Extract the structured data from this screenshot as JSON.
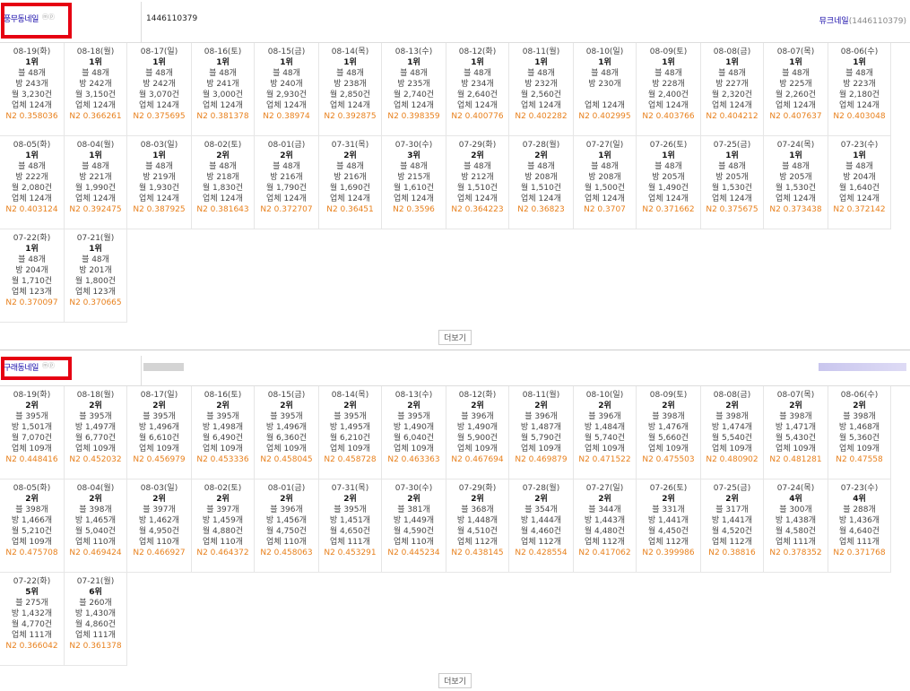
{
  "places": [
    {
      "name": "풍무동네일",
      "badges": "ⓜⓟ",
      "place_id": "1446110379",
      "right_name": "뮤크네일",
      "right_id": "(1446110379)",
      "more_label": "더보기",
      "days": [
        {
          "date": "08-19(화)",
          "rank": "1위",
          "l1": "블 48개",
          "l2": "방 243개",
          "l3": "월 3,230건",
          "l4": "업체 124개",
          "n2": "N2 0.358036"
        },
        {
          "date": "08-18(월)",
          "rank": "1위",
          "l1": "블 48개",
          "l2": "방 242개",
          "l3": "월 3,150건",
          "l4": "업체 124개",
          "n2": "N2 0.366261"
        },
        {
          "date": "08-17(일)",
          "rank": "1위",
          "l1": "블 48개",
          "l2": "방 242개",
          "l3": "월 3,070건",
          "l4": "업체 124개",
          "n2": "N2 0.375695"
        },
        {
          "date": "08-16(토)",
          "rank": "1위",
          "l1": "블 48개",
          "l2": "방 241개",
          "l3": "월 3,000건",
          "l4": "업체 124개",
          "n2": "N2 0.381378"
        },
        {
          "date": "08-15(금)",
          "rank": "1위",
          "l1": "블 48개",
          "l2": "방 240개",
          "l3": "월 2,930건",
          "l4": "업체 124개",
          "n2": "N2 0.38974"
        },
        {
          "date": "08-14(목)",
          "rank": "1위",
          "l1": "블 48개",
          "l2": "방 238개",
          "l3": "월 2,850건",
          "l4": "업체 124개",
          "n2": "N2 0.392875"
        },
        {
          "date": "08-13(수)",
          "rank": "1위",
          "l1": "블 48개",
          "l2": "방 235개",
          "l3": "월 2,740건",
          "l4": "업체 124개",
          "n2": "N2 0.398359"
        },
        {
          "date": "08-12(화)",
          "rank": "1위",
          "l1": "블 48개",
          "l2": "방 234개",
          "l3": "월 2,640건",
          "l4": "업체 124개",
          "n2": "N2 0.400776"
        },
        {
          "date": "08-11(월)",
          "rank": "1위",
          "l1": "블 48개",
          "l2": "방 232개",
          "l3": "월 2,560건",
          "l4": "업체 124개",
          "n2": "N2 0.402282"
        },
        {
          "date": "08-10(일)",
          "rank": "1위",
          "l1": "블 48개",
          "l2": "방 230개",
          "l3": "",
          "l4": "업체 124개",
          "n2": "N2 0.402995"
        },
        {
          "date": "08-09(토)",
          "rank": "1위",
          "l1": "블 48개",
          "l2": "방 228개",
          "l3": "월 2,400건",
          "l4": "업체 124개",
          "n2": "N2 0.403766"
        },
        {
          "date": "08-08(금)",
          "rank": "1위",
          "l1": "블 48개",
          "l2": "방 227개",
          "l3": "월 2,320건",
          "l4": "업체 124개",
          "n2": "N2 0.404212"
        },
        {
          "date": "08-07(목)",
          "rank": "1위",
          "l1": "블 48개",
          "l2": "방 225개",
          "l3": "월 2,260건",
          "l4": "업체 124개",
          "n2": "N2 0.407637"
        },
        {
          "date": "08-06(수)",
          "rank": "1위",
          "l1": "블 48개",
          "l2": "방 223개",
          "l3": "월 2,180건",
          "l4": "업체 124개",
          "n2": "N2 0.403048"
        },
        {
          "date": "08-05(화)",
          "rank": "1위",
          "l1": "블 48개",
          "l2": "방 222개",
          "l3": "월 2,080건",
          "l4": "업체 124개",
          "n2": "N2 0.403124"
        },
        {
          "date": "08-04(월)",
          "rank": "1위",
          "l1": "블 48개",
          "l2": "방 221개",
          "l3": "월 1,990건",
          "l4": "업체 124개",
          "n2": "N2 0.392475"
        },
        {
          "date": "08-03(일)",
          "rank": "1위",
          "l1": "블 48개",
          "l2": "방 219개",
          "l3": "월 1,930건",
          "l4": "업체 124개",
          "n2": "N2 0.387925"
        },
        {
          "date": "08-02(토)",
          "rank": "2위",
          "l1": "블 48개",
          "l2": "방 218개",
          "l3": "월 1,830건",
          "l4": "업체 124개",
          "n2": "N2 0.381643"
        },
        {
          "date": "08-01(금)",
          "rank": "2위",
          "l1": "블 48개",
          "l2": "방 216개",
          "l3": "월 1,790건",
          "l4": "업체 124개",
          "n2": "N2 0.372707"
        },
        {
          "date": "07-31(목)",
          "rank": "2위",
          "l1": "블 48개",
          "l2": "방 216개",
          "l3": "월 1,690건",
          "l4": "업체 124개",
          "n2": "N2 0.36451"
        },
        {
          "date": "07-30(수)",
          "rank": "3위",
          "l1": "블 48개",
          "l2": "방 215개",
          "l3": "월 1,610건",
          "l4": "업체 124개",
          "n2": "N2 0.3596"
        },
        {
          "date": "07-29(화)",
          "rank": "2위",
          "l1": "블 48개",
          "l2": "방 212개",
          "l3": "월 1,510건",
          "l4": "업체 124개",
          "n2": "N2 0.364223"
        },
        {
          "date": "07-28(월)",
          "rank": "2위",
          "l1": "블 48개",
          "l2": "방 208개",
          "l3": "월 1,510건",
          "l4": "업체 124개",
          "n2": "N2 0.36823"
        },
        {
          "date": "07-27(일)",
          "rank": "1위",
          "l1": "블 48개",
          "l2": "방 208개",
          "l3": "월 1,500건",
          "l4": "업체 124개",
          "n2": "N2 0.3707"
        },
        {
          "date": "07-26(토)",
          "rank": "1위",
          "l1": "블 48개",
          "l2": "방 205개",
          "l3": "월 1,490건",
          "l4": "업체 124개",
          "n2": "N2 0.371662"
        },
        {
          "date": "07-25(금)",
          "rank": "1위",
          "l1": "블 48개",
          "l2": "방 205개",
          "l3": "월 1,530건",
          "l4": "업체 124개",
          "n2": "N2 0.375675"
        },
        {
          "date": "07-24(목)",
          "rank": "1위",
          "l1": "블 48개",
          "l2": "방 205개",
          "l3": "월 1,530건",
          "l4": "업체 124개",
          "n2": "N2 0.373438"
        },
        {
          "date": "07-23(수)",
          "rank": "1위",
          "l1": "블 48개",
          "l2": "방 204개",
          "l3": "월 1,640건",
          "l4": "업체 124개",
          "n2": "N2 0.372142"
        },
        {
          "date": "07-22(화)",
          "rank": "1위",
          "l1": "블 48개",
          "l2": "방 204개",
          "l3": "월 1,710건",
          "l4": "업체 123개",
          "n2": "N2 0.370097"
        },
        {
          "date": "07-21(월)",
          "rank": "1위",
          "l1": "블 48개",
          "l2": "방 201개",
          "l3": "월 1,800건",
          "l4": "업체 123개",
          "n2": "N2 0.370665"
        }
      ]
    },
    {
      "name": "구래동네일",
      "badges": "ⓜⓟ",
      "place_id": "",
      "right_name": "",
      "right_id": "",
      "more_label": "더보기",
      "days": [
        {
          "date": "08-19(화)",
          "rank": "2위",
          "l1": "블 395개",
          "l2": "방 1,501개",
          "l3": "월 7,070건",
          "l4": "업체 109개",
          "n2": "N2 0.448416"
        },
        {
          "date": "08-18(월)",
          "rank": "2위",
          "l1": "블 395개",
          "l2": "방 1,497개",
          "l3": "월 6,770건",
          "l4": "업체 109개",
          "n2": "N2 0.452032"
        },
        {
          "date": "08-17(일)",
          "rank": "2위",
          "l1": "블 395개",
          "l2": "방 1,496개",
          "l3": "월 6,610건",
          "l4": "업체 109개",
          "n2": "N2 0.456979"
        },
        {
          "date": "08-16(토)",
          "rank": "2위",
          "l1": "블 395개",
          "l2": "방 1,498개",
          "l3": "월 6,490건",
          "l4": "업체 109개",
          "n2": "N2 0.453336"
        },
        {
          "date": "08-15(금)",
          "rank": "2위",
          "l1": "블 395개",
          "l2": "방 1,496개",
          "l3": "월 6,360건",
          "l4": "업체 109개",
          "n2": "N2 0.458045"
        },
        {
          "date": "08-14(목)",
          "rank": "2위",
          "l1": "블 395개",
          "l2": "방 1,495개",
          "l3": "월 6,210건",
          "l4": "업체 109개",
          "n2": "N2 0.458728"
        },
        {
          "date": "08-13(수)",
          "rank": "2위",
          "l1": "블 395개",
          "l2": "방 1,490개",
          "l3": "월 6,040건",
          "l4": "업체 109개",
          "n2": "N2 0.463363"
        },
        {
          "date": "08-12(화)",
          "rank": "2위",
          "l1": "블 396개",
          "l2": "방 1,490개",
          "l3": "월 5,900건",
          "l4": "업체 109개",
          "n2": "N2 0.467694"
        },
        {
          "date": "08-11(월)",
          "rank": "2위",
          "l1": "블 396개",
          "l2": "방 1,487개",
          "l3": "월 5,790건",
          "l4": "업체 109개",
          "n2": "N2 0.469879"
        },
        {
          "date": "08-10(일)",
          "rank": "2위",
          "l1": "블 396개",
          "l2": "방 1,484개",
          "l3": "월 5,740건",
          "l4": "업체 109개",
          "n2": "N2 0.471522"
        },
        {
          "date": "08-09(토)",
          "rank": "2위",
          "l1": "블 398개",
          "l2": "방 1,476개",
          "l3": "월 5,660건",
          "l4": "업체 109개",
          "n2": "N2 0.475503"
        },
        {
          "date": "08-08(금)",
          "rank": "2위",
          "l1": "블 398개",
          "l2": "방 1,474개",
          "l3": "월 5,540건",
          "l4": "업체 109개",
          "n2": "N2 0.480902"
        },
        {
          "date": "08-07(목)",
          "rank": "2위",
          "l1": "블 398개",
          "l2": "방 1,471개",
          "l3": "월 5,430건",
          "l4": "업체 109개",
          "n2": "N2 0.481281"
        },
        {
          "date": "08-06(수)",
          "rank": "2위",
          "l1": "블 398개",
          "l2": "방 1,468개",
          "l3": "월 5,360건",
          "l4": "업체 109개",
          "n2": "N2 0.47558"
        },
        {
          "date": "08-05(화)",
          "rank": "2위",
          "l1": "블 398개",
          "l2": "방 1,466개",
          "l3": "월 5,210건",
          "l4": "업체 109개",
          "n2": "N2 0.475708"
        },
        {
          "date": "08-04(월)",
          "rank": "2위",
          "l1": "블 398개",
          "l2": "방 1,465개",
          "l3": "월 5,040건",
          "l4": "업체 110개",
          "n2": "N2 0.469424"
        },
        {
          "date": "08-03(일)",
          "rank": "2위",
          "l1": "블 397개",
          "l2": "방 1,462개",
          "l3": "월 4,950건",
          "l4": "업체 110개",
          "n2": "N2 0.466927"
        },
        {
          "date": "08-02(토)",
          "rank": "2위",
          "l1": "블 397개",
          "l2": "방 1,459개",
          "l3": "월 4,880건",
          "l4": "업체 110개",
          "n2": "N2 0.464372"
        },
        {
          "date": "08-01(금)",
          "rank": "2위",
          "l1": "블 396개",
          "l2": "방 1,456개",
          "l3": "월 4,750건",
          "l4": "업체 110개",
          "n2": "N2 0.458063"
        },
        {
          "date": "07-31(목)",
          "rank": "2위",
          "l1": "블 395개",
          "l2": "방 1,451개",
          "l3": "월 4,650건",
          "l4": "업체 111개",
          "n2": "N2 0.453291"
        },
        {
          "date": "07-30(수)",
          "rank": "2위",
          "l1": "블 381개",
          "l2": "방 1,449개",
          "l3": "월 4,590건",
          "l4": "업체 110개",
          "n2": "N2 0.445234"
        },
        {
          "date": "07-29(화)",
          "rank": "2위",
          "l1": "블 368개",
          "l2": "방 1,448개",
          "l3": "월 4,510건",
          "l4": "업체 112개",
          "n2": "N2 0.438145"
        },
        {
          "date": "07-28(월)",
          "rank": "2위",
          "l1": "블 354개",
          "l2": "방 1,444개",
          "l3": "월 4,460건",
          "l4": "업체 112개",
          "n2": "N2 0.428554"
        },
        {
          "date": "07-27(일)",
          "rank": "2위",
          "l1": "블 344개",
          "l2": "방 1,443개",
          "l3": "월 4,480건",
          "l4": "업체 112개",
          "n2": "N2 0.417062"
        },
        {
          "date": "07-26(토)",
          "rank": "2위",
          "l1": "블 331개",
          "l2": "방 1,441개",
          "l3": "월 4,450건",
          "l4": "업체 112개",
          "n2": "N2 0.399986"
        },
        {
          "date": "07-25(금)",
          "rank": "2위",
          "l1": "블 317개",
          "l2": "방 1,441개",
          "l3": "월 4,520건",
          "l4": "업체 112개",
          "n2": "N2 0.38816"
        },
        {
          "date": "07-24(목)",
          "rank": "4위",
          "l1": "블 300개",
          "l2": "방 1,438개",
          "l3": "월 4,580건",
          "l4": "업체 111개",
          "n2": "N2 0.378352"
        },
        {
          "date": "07-23(수)",
          "rank": "4위",
          "l1": "블 288개",
          "l2": "방 1,436개",
          "l3": "월 4,640건",
          "l4": "업체 111개",
          "n2": "N2 0.371768"
        },
        {
          "date": "07-22(화)",
          "rank": "5위",
          "l1": "블 275개",
          "l2": "방 1,432개",
          "l3": "월 4,770건",
          "l4": "업체 111개",
          "n2": "N2 0.366042"
        },
        {
          "date": "07-21(월)",
          "rank": "6위",
          "l1": "블 260개",
          "l2": "방 1,430개",
          "l3": "월 4,860건",
          "l4": "업체 111개",
          "n2": "N2 0.361378"
        }
      ]
    }
  ]
}
